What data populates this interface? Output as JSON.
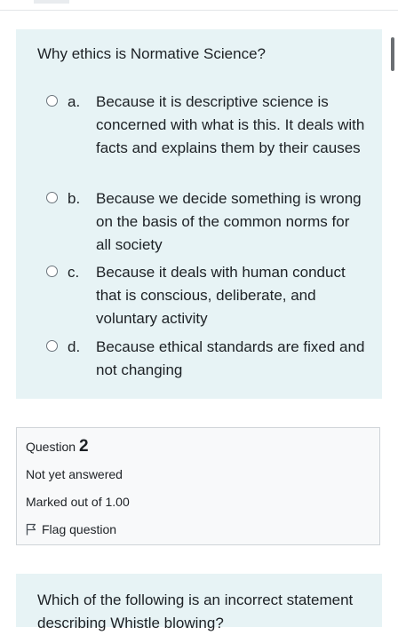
{
  "question1": {
    "text": "Why ethics is Normative Science?",
    "options": [
      {
        "letter": "a.",
        "text": "Because it is descriptive science is concerned with what is this. It deals with facts and explains them by their causes"
      },
      {
        "letter": "b.",
        "text": "Because we decide something is wrong on the basis of the common norms for all society"
      },
      {
        "letter": "c.",
        "text": "Because it deals with human conduct that is conscious, deliberate, and voluntary activity"
      },
      {
        "letter": "d.",
        "text": "Because ethical standards are fixed and not changing"
      }
    ]
  },
  "question2_info": {
    "label": "Question",
    "number": "2",
    "state": "Not yet answered",
    "marks": "Marked out of 1.00",
    "flag_label": "Flag question",
    "flag_icon": "flag-outline-icon"
  },
  "question2": {
    "text": "Which of the following is an incorrect statement describing Whistle blowing?"
  }
}
